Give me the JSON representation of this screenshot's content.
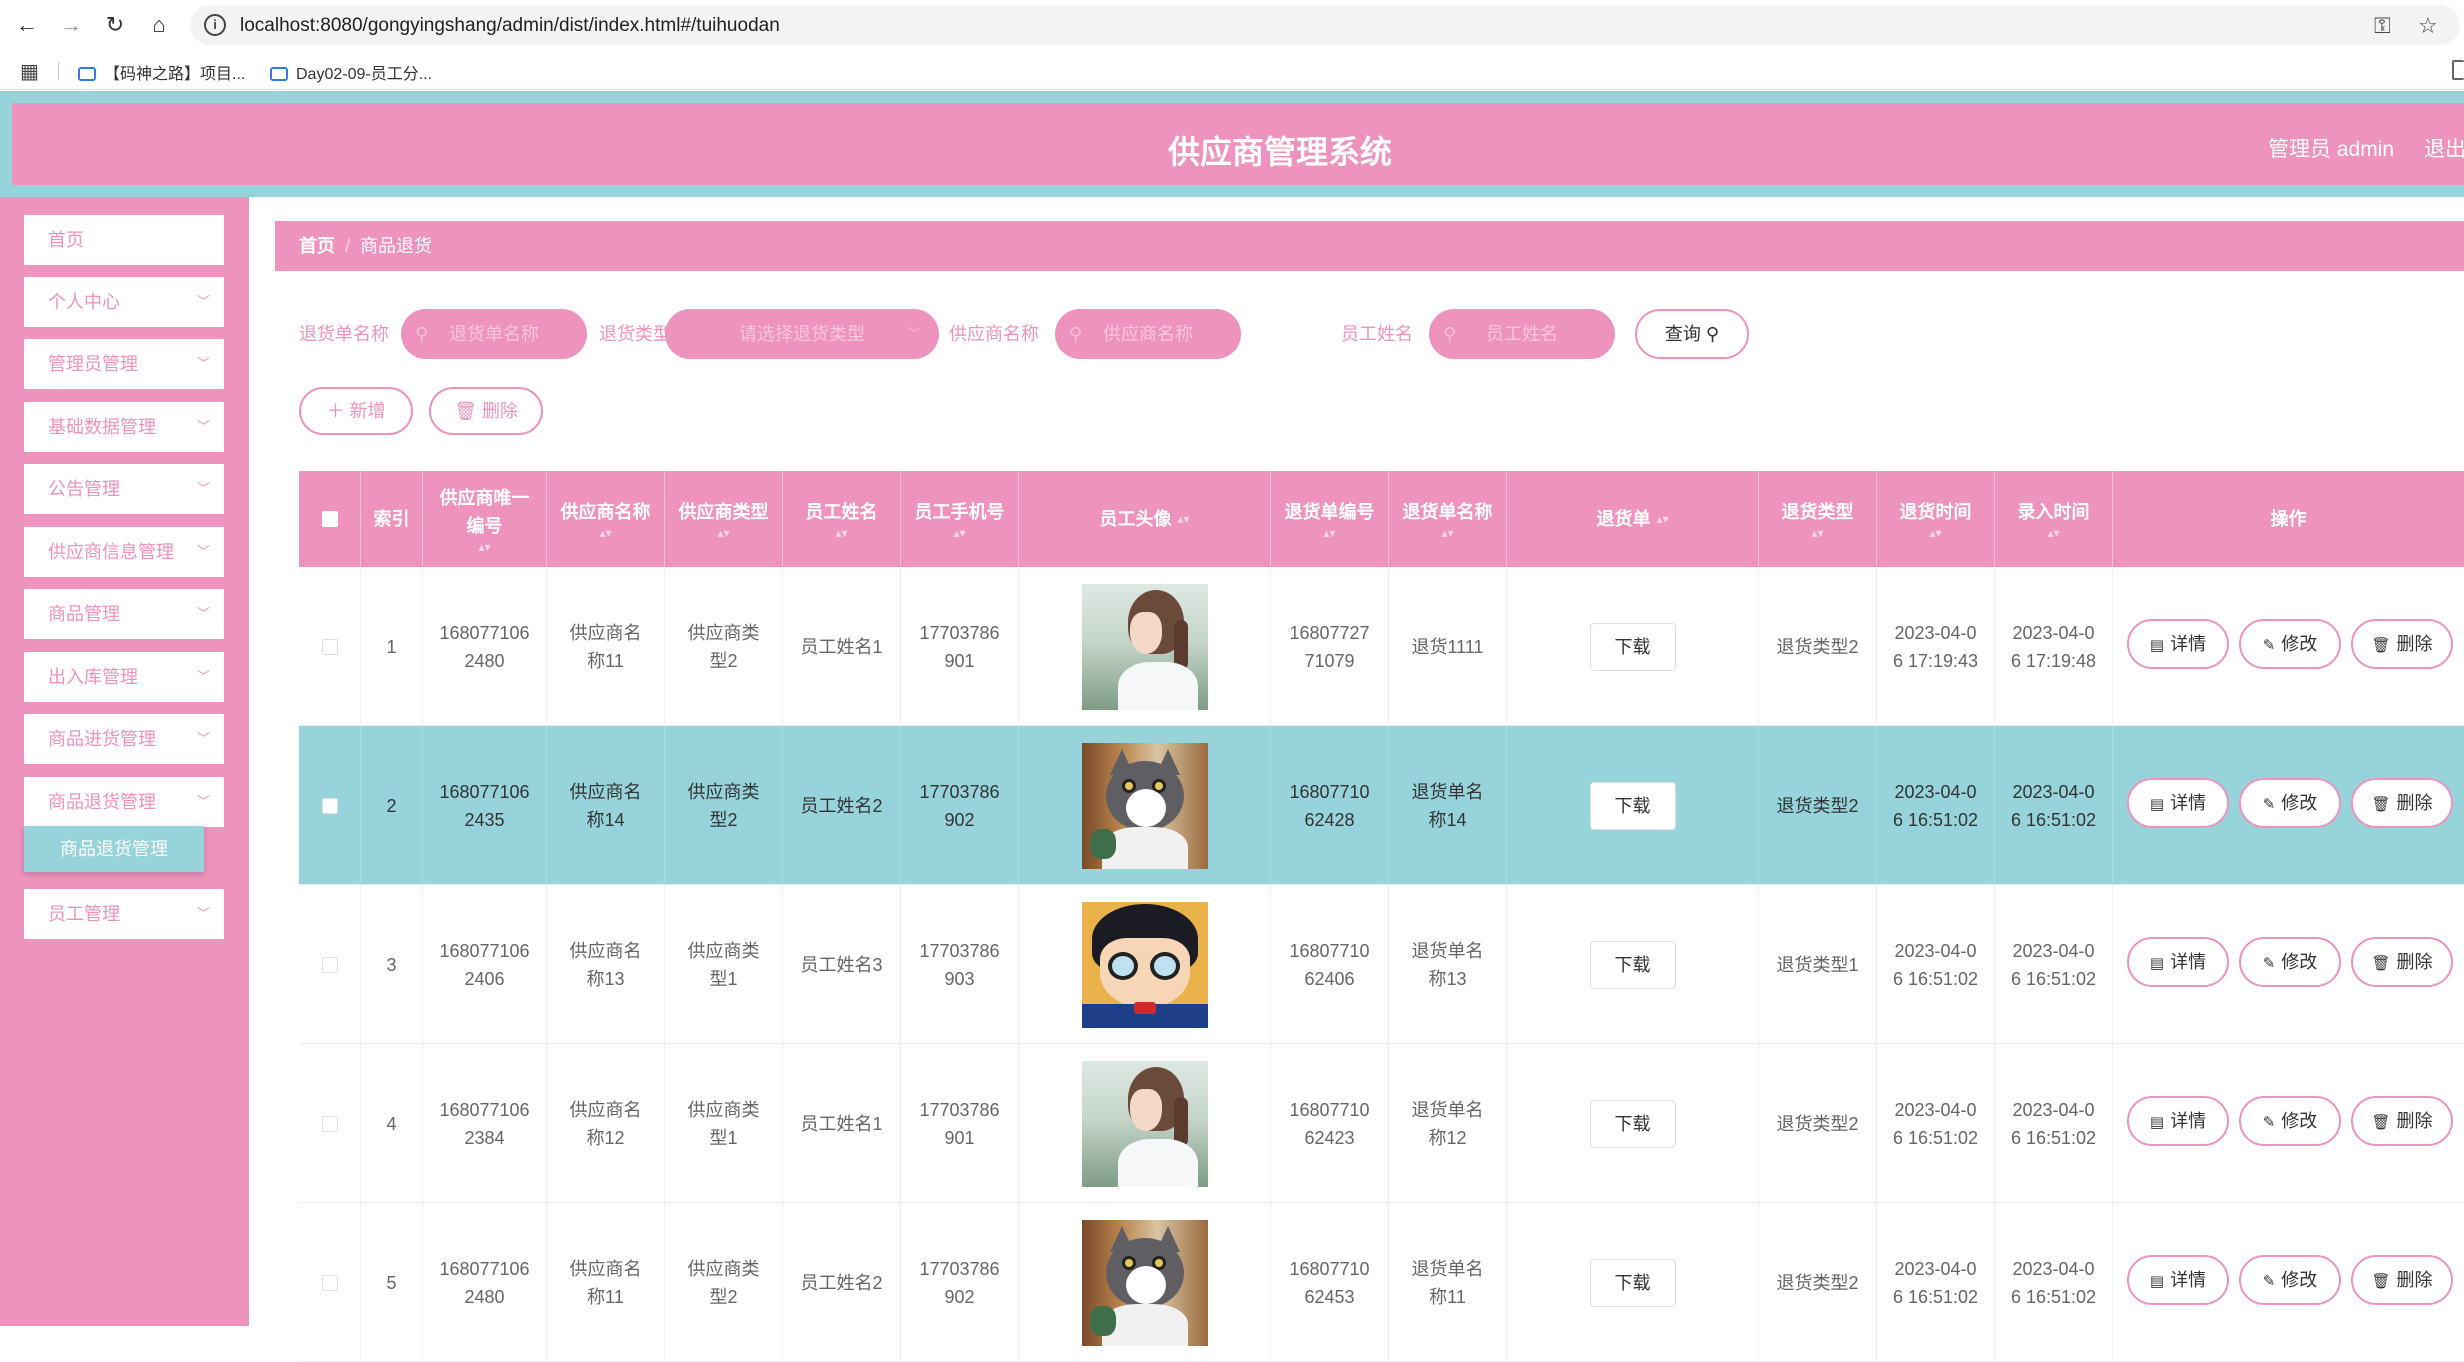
{
  "browser": {
    "url": "localhost:8080/gongyingshang/admin/dist/index.html#/tuihuodan",
    "bookmarks": [
      "【码神之路】项目...",
      "Day02-09-员工分..."
    ]
  },
  "header": {
    "title": "供应商管理系统",
    "admin": "管理员 admin",
    "logout": "退出"
  },
  "sidebar": {
    "items": [
      {
        "label": "首页",
        "has_children": false
      },
      {
        "label": "个人中心",
        "has_children": true
      },
      {
        "label": "管理员管理",
        "has_children": true
      },
      {
        "label": "基础数据管理",
        "has_children": true
      },
      {
        "label": "公告管理",
        "has_children": true
      },
      {
        "label": "供应商信息管理",
        "has_children": true
      },
      {
        "label": "商品管理",
        "has_children": true
      },
      {
        "label": "出入库管理",
        "has_children": true
      },
      {
        "label": "商品进货管理",
        "has_children": true
      },
      {
        "label": "商品退货管理",
        "has_children": true
      },
      {
        "label": "员工管理",
        "has_children": true
      }
    ],
    "active_sub": "商品退货管理"
  },
  "breadcrumb": {
    "home": "首页",
    "current": "商品退货"
  },
  "search": {
    "fields": [
      {
        "label": "退货单名称",
        "placeholder": "退货单名称"
      },
      {
        "label": "退货类型",
        "placeholder": "请选择退货类型"
      },
      {
        "label": "供应商名称",
        "placeholder": "供应商名称"
      },
      {
        "label": "员工姓名",
        "placeholder": "员工姓名"
      }
    ],
    "query_button": "查询"
  },
  "actions": {
    "add": "新增",
    "delete": "删除"
  },
  "table": {
    "headers": [
      "索引",
      "供应商唯一编号",
      "供应商名称",
      "供应商类型",
      "员工姓名",
      "员工手机号",
      "员工头像",
      "退货单编号",
      "退货单名称",
      "退货单",
      "退货类型",
      "退货时间",
      "录入时间",
      "操作"
    ],
    "download_label": "下载",
    "row_actions": {
      "detail": "详情",
      "edit": "修改",
      "delete": "删除"
    },
    "rows": [
      {
        "index": "1",
        "supplier_no": "1680771062480",
        "supplier_name": "供应商名称11",
        "supplier_type": "供应商类型2",
        "employee_name": "员工姓名1",
        "employee_phone": "17703786901",
        "avatar": "girl",
        "return_no": "1680772771079",
        "return_name": "退货1111",
        "return_type": "退货类型2",
        "return_time": "2023-04-06 17:19:43",
        "entry_time": "2023-04-06 17:19:48",
        "highlighted": false
      },
      {
        "index": "2",
        "supplier_no": "1680771062435",
        "supplier_name": "供应商名称14",
        "supplier_type": "供应商类型2",
        "employee_name": "员工姓名2",
        "employee_phone": "17703786902",
        "avatar": "cat",
        "return_no": "1680771062428",
        "return_name": "退货单名称14",
        "return_type": "退货类型2",
        "return_time": "2023-04-06 16:51:02",
        "entry_time": "2023-04-06 16:51:02",
        "highlighted": true
      },
      {
        "index": "3",
        "supplier_no": "1680771062406",
        "supplier_name": "供应商名称13",
        "supplier_type": "供应商类型1",
        "employee_name": "员工姓名3",
        "employee_phone": "17703786903",
        "avatar": "conan",
        "return_no": "1680771062406",
        "return_name": "退货单名称13",
        "return_type": "退货类型1",
        "return_time": "2023-04-06 16:51:02",
        "entry_time": "2023-04-06 16:51:02",
        "highlighted": false
      },
      {
        "index": "4",
        "supplier_no": "1680771062384",
        "supplier_name": "供应商名称12",
        "supplier_type": "供应商类型1",
        "employee_name": "员工姓名1",
        "employee_phone": "17703786901",
        "avatar": "girl",
        "return_no": "1680771062423",
        "return_name": "退货单名称12",
        "return_type": "退货类型2",
        "return_time": "2023-04-06 16:51:02",
        "entry_time": "2023-04-06 16:51:02",
        "highlighted": false
      },
      {
        "index": "5",
        "supplier_no": "1680771062480",
        "supplier_name": "供应商名称11",
        "supplier_type": "供应商类型2",
        "employee_name": "员工姓名2",
        "employee_phone": "17703786902",
        "avatar": "cat",
        "return_no": "1680771062453",
        "return_name": "退货单名称11",
        "return_type": "退货类型2",
        "return_time": "2023-04-06 16:51:02",
        "entry_time": "2023-04-06 16:51:02",
        "highlighted": false
      }
    ]
  },
  "colors": {
    "pink": "#ee93bd",
    "teal": "#96d3db"
  }
}
